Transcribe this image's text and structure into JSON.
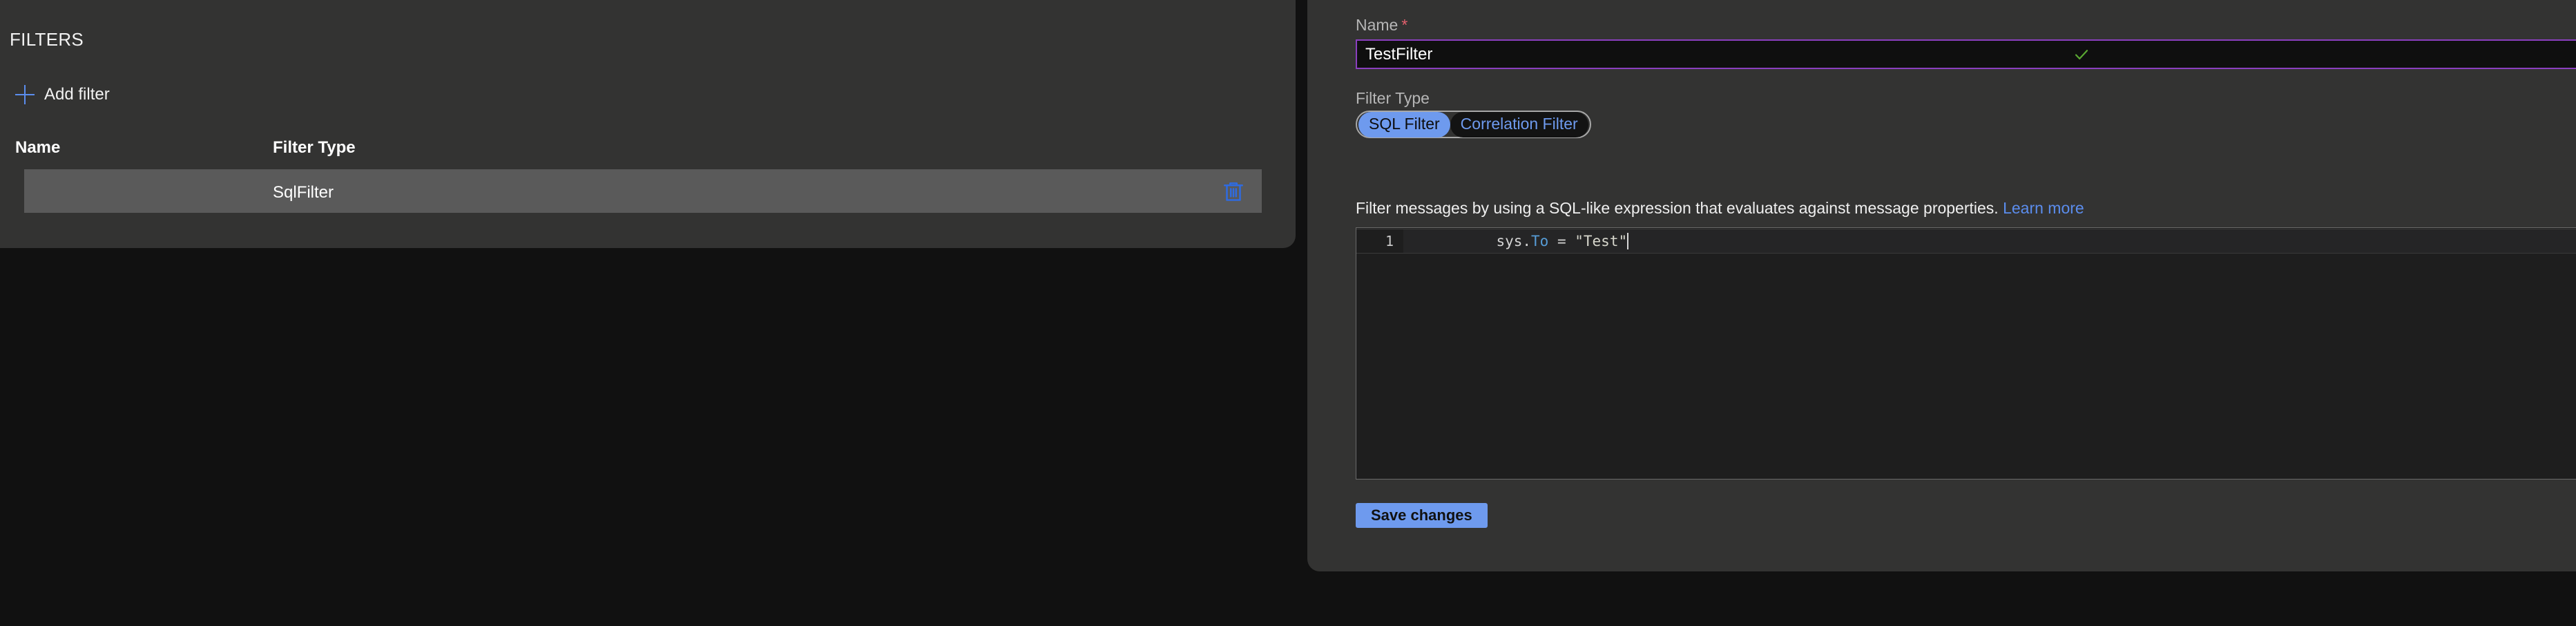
{
  "filters_panel": {
    "title": "FILTERS",
    "add_filter_label": "Add filter",
    "columns": {
      "name": "Name",
      "filter_type": "Filter Type"
    },
    "rows": [
      {
        "name": "",
        "filter_type": "SqlFilter",
        "delete_icon": "trash-icon"
      }
    ]
  },
  "detail_panel": {
    "name_label": "Name",
    "name_required_marker": "*",
    "name_value": "TestFilter",
    "name_placeholder": "",
    "name_valid_icon": "check-icon",
    "filter_type_label": "Filter Type",
    "filter_type_options": [
      {
        "label": "SQL Filter",
        "selected": true
      },
      {
        "label": "Correlation Filter",
        "selected": false
      }
    ],
    "description_text": "Filter messages by using a SQL-like expression that evaluates against message properties.",
    "description_link": "Learn more",
    "editor": {
      "line_number": "1",
      "tokens": [
        {
          "text": "sys.",
          "kind": "plain"
        },
        {
          "text": "To",
          "kind": "prop"
        },
        {
          "text": " = ",
          "kind": "plain"
        },
        {
          "text": "\"Test\"",
          "kind": "str"
        }
      ],
      "full_text": "sys.To = \"Test\""
    },
    "save_label": "Save changes"
  },
  "colors": {
    "panel_bg": "#333332",
    "page_bg": "#111111",
    "accent_blue": "#6e9aee",
    "link_blue": "#5b8dee",
    "focus_purple": "#8a3fbf",
    "valid_green": "#5aa832",
    "required_red": "#e4606d",
    "row_selected": "#5a5a5a",
    "editor_bg": "#1e1e1e"
  }
}
